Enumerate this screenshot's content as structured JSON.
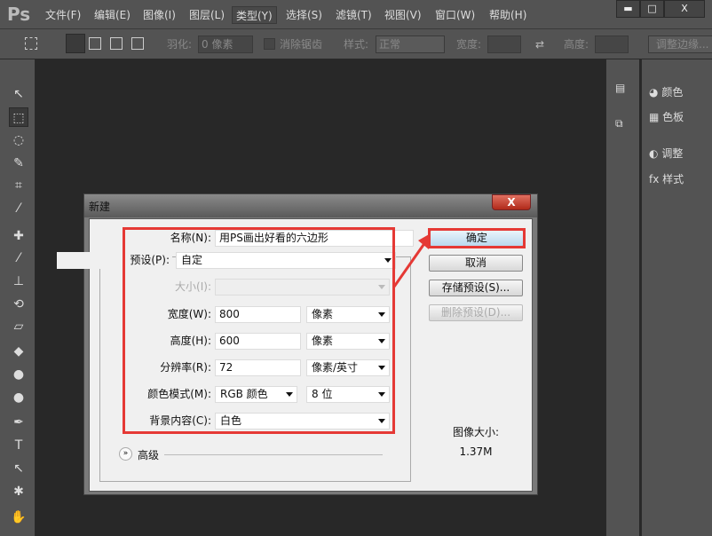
{
  "app": {
    "logo": "Ps"
  },
  "menu": [
    "文件(F)",
    "编辑(E)",
    "图像(I)",
    "图层(L)",
    "类型(Y)",
    "选择(S)",
    "滤镜(T)",
    "视图(V)",
    "窗口(W)",
    "帮助(H)"
  ],
  "window_controls": {
    "minimize": "▬",
    "maximize": "□",
    "close": "X"
  },
  "options": {
    "feather_label": "羽化:",
    "feather_value": "0 像素",
    "antialias": "消除锯齿",
    "style_label": "样式:",
    "style_value": "正常",
    "width_label": "宽度:",
    "height_label": "高度:",
    "refine_edge": "调整边缘..."
  },
  "panels": [
    {
      "label": "颜色",
      "icon": "palette"
    },
    {
      "label": "色板",
      "icon": "grid"
    },
    {
      "label": "调整",
      "icon": "half-circle"
    },
    {
      "label": "样式",
      "icon": "fx"
    }
  ],
  "dialog": {
    "title": "新建",
    "close": "X",
    "name_label": "名称(N):",
    "name_value": "用PS画出好看的六边形",
    "preset_label": "预设(P):",
    "preset_value": "自定",
    "size_label": "大小(I):",
    "size_value": "",
    "width_label": "宽度(W):",
    "width_value": "800",
    "width_unit": "像素",
    "height_label": "高度(H):",
    "height_value": "600",
    "height_unit": "像素",
    "resolution_label": "分辨率(R):",
    "resolution_value": "72",
    "resolution_unit": "像素/英寸",
    "color_mode_label": "颜色模式(M):",
    "color_mode_value": "RGB 颜色",
    "bit_depth": "8 位",
    "background_label": "背景内容(C):",
    "background_value": "白色",
    "advanced_label": "高级",
    "ok": "确定",
    "cancel": "取消",
    "save_preset": "存储预设(S)...",
    "delete_preset": "删除预设(D)...",
    "image_size_label": "图像大小:",
    "image_size_value": "1.37M"
  },
  "colors": {
    "highlight": "#e53935"
  }
}
